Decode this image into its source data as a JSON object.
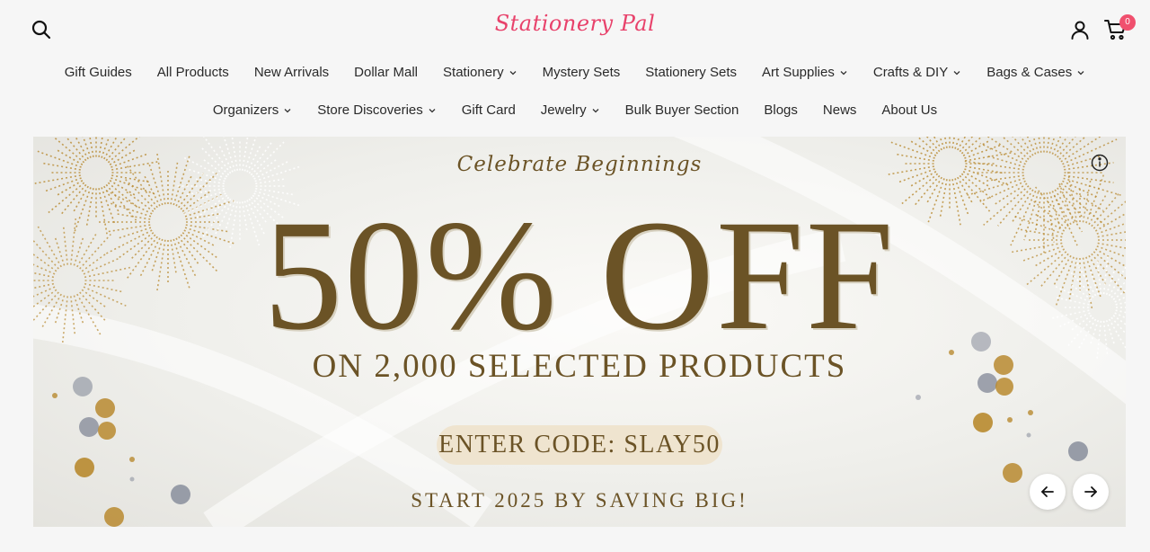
{
  "header": {
    "logo_text": "Stationery Pal",
    "cart_count": "0",
    "icons": {
      "search": "search-icon",
      "account": "user-icon",
      "cart": "cart-icon"
    }
  },
  "nav": {
    "row1": [
      {
        "label": "Gift Guides",
        "dropdown": false
      },
      {
        "label": "All Products",
        "dropdown": false
      },
      {
        "label": "New Arrivals",
        "dropdown": false
      },
      {
        "label": "Dollar Mall",
        "dropdown": false
      },
      {
        "label": "Stationery",
        "dropdown": true
      },
      {
        "label": "Mystery Sets",
        "dropdown": false
      },
      {
        "label": "Stationery Sets",
        "dropdown": false
      },
      {
        "label": "Art Supplies",
        "dropdown": true
      },
      {
        "label": "Crafts & DIY",
        "dropdown": true
      },
      {
        "label": "Bags & Cases",
        "dropdown": true
      }
    ],
    "row2": [
      {
        "label": "Organizers",
        "dropdown": true
      },
      {
        "label": "Store Discoveries",
        "dropdown": true
      },
      {
        "label": "Gift Card",
        "dropdown": false
      },
      {
        "label": "Jewelry",
        "dropdown": true
      },
      {
        "label": "Bulk Buyer Section",
        "dropdown": false
      },
      {
        "label": "Blogs",
        "dropdown": false
      },
      {
        "label": "News",
        "dropdown": false
      },
      {
        "label": "About Us",
        "dropdown": false
      }
    ]
  },
  "banner": {
    "tagline": "Celebrate Beginnings",
    "headline": "50% OFF",
    "subline": "ON 2,000 SELECTED PRODUCTS",
    "code_text": "ENTER CODE:  SLAY50",
    "footline": "START 2025 BY SAVING BIG!"
  },
  "colors": {
    "brand": "#e8426b",
    "badge": "#f0506e",
    "banner_text": "#6b5326",
    "gold": "#b8892f",
    "silver": "#8e93a0",
    "pill": "#efe4cf"
  }
}
